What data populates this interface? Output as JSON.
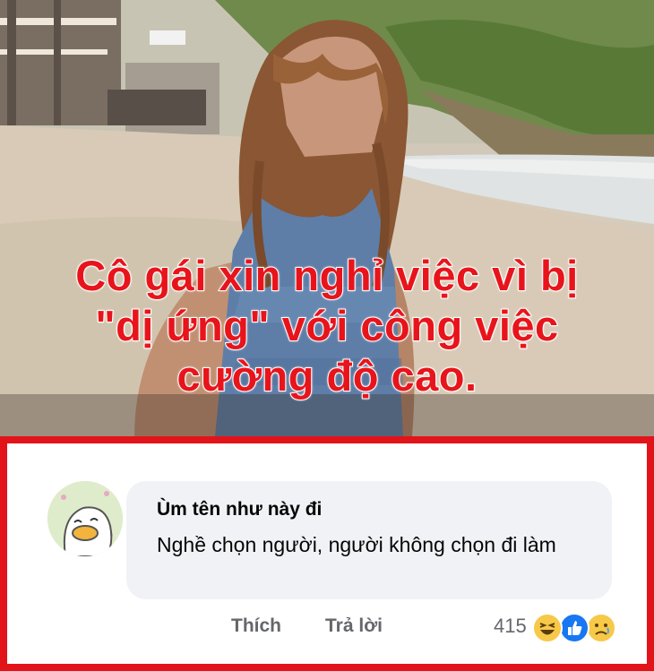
{
  "headline": {
    "lines": [
      "Cô gái xin nghỉ việc vì bị",
      "\"dị ứng\" với công việc",
      "cường độ cao."
    ]
  },
  "comment": {
    "author": "Ùm tên như này đi",
    "text": "Nghề chọn người, người không chọn đi làm",
    "actions": {
      "like": "Thích",
      "reply": "Trả lời"
    },
    "reaction_count": "415",
    "reaction_icons": [
      "haha-icon",
      "like-icon",
      "sad-icon"
    ]
  },
  "colors": {
    "headline": "#e8141b",
    "frame_border": "#e3131a",
    "bubble": "#f0f2f5",
    "secondary_text": "#65676b"
  }
}
